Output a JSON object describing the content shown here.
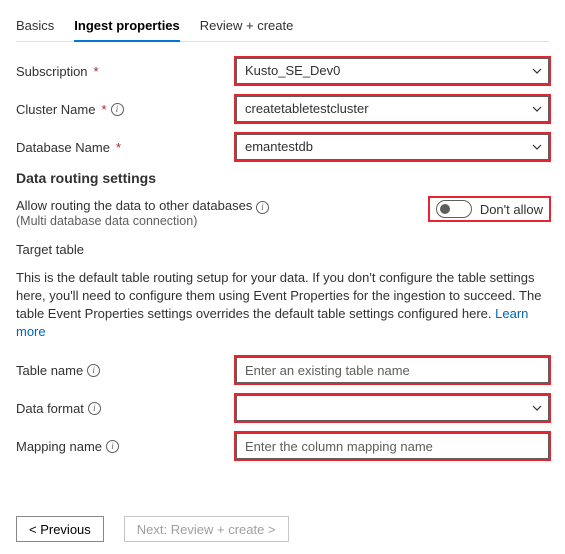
{
  "tabs": {
    "basics": "Basics",
    "ingest": "Ingest properties",
    "review": "Review + create"
  },
  "fields": {
    "subscription": {
      "label": "Subscription",
      "value": "Kusto_SE_Dev0"
    },
    "cluster": {
      "label": "Cluster Name",
      "value": "createtabletestcluster"
    },
    "database": {
      "label": "Database Name",
      "value": "emantestdb"
    }
  },
  "section": {
    "routing_heading": "Data routing settings",
    "allow_routing_line1": "Allow routing the data to other databases",
    "allow_routing_line2": "(Multi database data connection)",
    "toggle_state": "Don't allow",
    "target_table": "Target table",
    "description_part1": "This is the default table routing setup for your data. If you don't configure the table settings here, you'll need to configure them using Event Properties for the ingestion to succeed. The table Event Properties settings overrides the default table settings configured here. ",
    "learn_more": "Learn more"
  },
  "table_fields": {
    "table_name": {
      "label": "Table name",
      "placeholder": "Enter an existing table name"
    },
    "data_format": {
      "label": "Data format",
      "value": ""
    },
    "mapping_name": {
      "label": "Mapping name",
      "placeholder": "Enter the column mapping name"
    }
  },
  "footer": {
    "prev": "<  Previous",
    "next": "Next: Review + create  >"
  }
}
